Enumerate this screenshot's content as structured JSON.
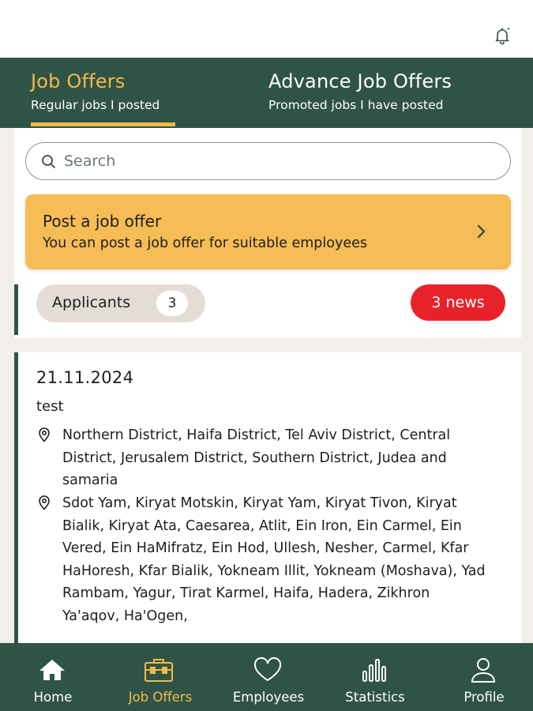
{
  "header": {
    "bell_icon": "bell-icon"
  },
  "tabs": [
    {
      "title": "Job Offers",
      "subtitle": "Regular jobs I posted",
      "active": true
    },
    {
      "title": "Advance Job Offers",
      "subtitle": "Promoted jobs I have posted",
      "active": false
    }
  ],
  "search": {
    "placeholder": "Search",
    "value": ""
  },
  "post_card": {
    "title": "Post a job offer",
    "subtitle": "You can post a job offer for suitable employees"
  },
  "applicants": {
    "label": "Applicants",
    "count": "3",
    "news": "3 news"
  },
  "job": {
    "date": "21.11.2024",
    "title": "test",
    "districts": "Northern District, Haifa District, Tel Aviv District, Central District, Jerusalem District, Southern District, Judea and samaria",
    "cities": "Sdot Yam, Kiryat Motskin, Kiryat Yam, Kiryat Tivon, Kiryat Bialik, Kiryat Ata, Caesarea, Atlit, Ein Iron, Ein Carmel, Ein Vered, Ein HaMifratz, Ein Hod, Ullesh, Nesher, Carmel, Kfar HaHoresh, Kfar Bialik, Yokneam Illit, Yokneam (Moshava), Yad Rambam, Yagur, Tirat Karmel, Haifa, Hadera, Zikhron Ya'aqov, Ha'Ogen,"
  },
  "bottom_nav": [
    {
      "label": "Home",
      "icon": "home-icon",
      "active": false
    },
    {
      "label": "Job Offers",
      "icon": "briefcase-icon",
      "active": true
    },
    {
      "label": "Employees",
      "icon": "heart-icon",
      "active": false
    },
    {
      "label": "Statistics",
      "icon": "bar-chart-icon",
      "active": false
    },
    {
      "label": "Profile",
      "icon": "user-icon",
      "active": false
    }
  ],
  "colors": {
    "brand_green": "#2f5446",
    "accent_yellow": "#f5b94a",
    "card_yellow": "#f6bc55",
    "news_red": "#e8222b",
    "background": "#f2efea"
  }
}
